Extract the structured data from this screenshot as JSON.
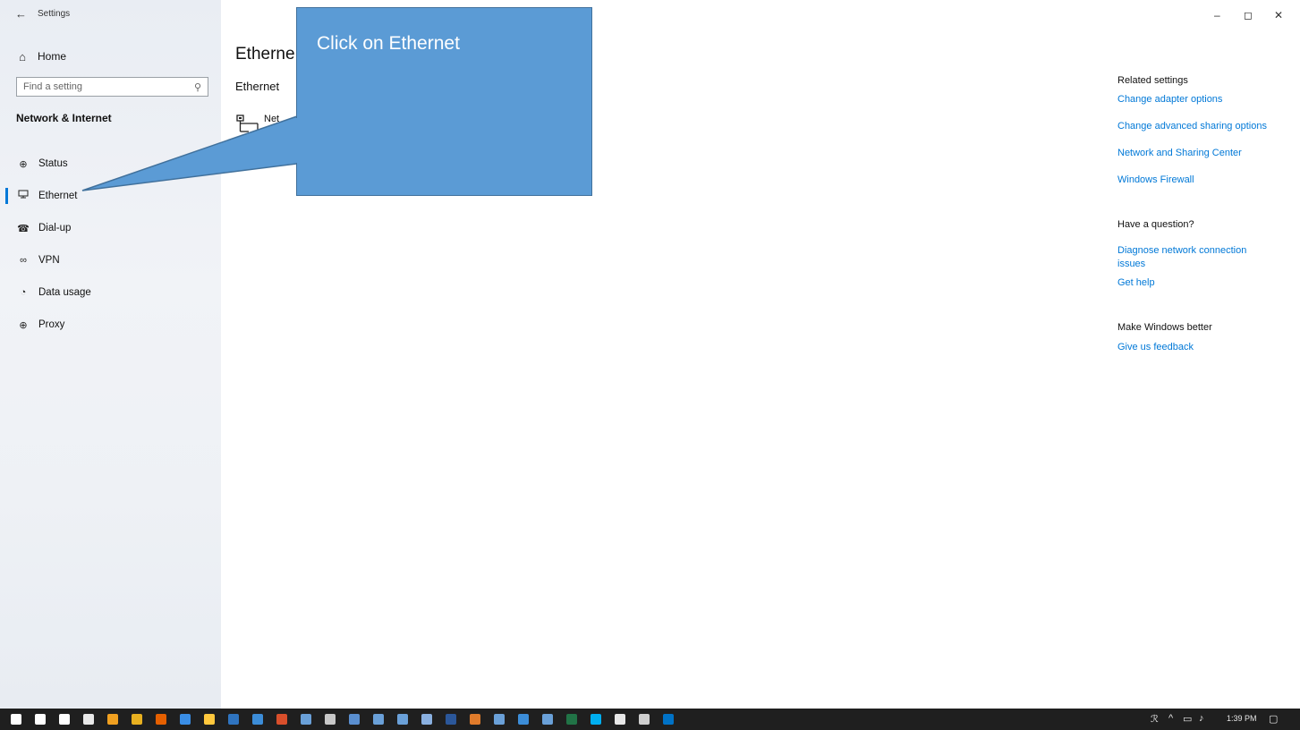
{
  "window": {
    "title": "Settings",
    "back_icon": "back-arrow-icon",
    "minimize": "–",
    "maximize": "◻",
    "close": "✕"
  },
  "sidebar": {
    "home_label": "Home",
    "search_placeholder": "Find a setting",
    "section_title": "Network & Internet",
    "items": [
      {
        "label": "Status",
        "icon": "status-globe-icon",
        "glyph": "⊕",
        "active": false
      },
      {
        "label": "Ethernet",
        "icon": "ethernet-icon",
        "glyph": "🖧",
        "active": true
      },
      {
        "label": "Dial-up",
        "icon": "dial-up-icon",
        "glyph": "☎",
        "active": false
      },
      {
        "label": "VPN",
        "icon": "vpn-icon",
        "glyph": "∞",
        "active": false
      },
      {
        "label": "Data usage",
        "icon": "data-usage-icon",
        "glyph": "◔",
        "active": false
      },
      {
        "label": "Proxy",
        "icon": "proxy-globe-icon",
        "glyph": "⊕",
        "active": false
      }
    ]
  },
  "main": {
    "title": "Etherne",
    "subtitle": "Ethernet",
    "network_name": "Net"
  },
  "callout": {
    "text": "Click on Ethernet",
    "fill": "#5b9bd5",
    "border": "#41719c"
  },
  "right_panel": {
    "related_heading": "Related settings",
    "related_links": [
      "Change adapter options",
      "Change advanced sharing options",
      "Network and Sharing Center",
      "Windows Firewall"
    ],
    "question_heading": "Have a question?",
    "question_links": [
      "Diagnose network connection issues",
      "Get help"
    ],
    "better_heading": "Make Windows better",
    "better_links": [
      "Give us feedback"
    ]
  },
  "taskbar": {
    "time": "1:39 PM",
    "apps": [
      {
        "name": "start-button",
        "color": "#ffffff"
      },
      {
        "name": "cortana-search",
        "color": "#ffffff"
      },
      {
        "name": "task-view",
        "color": "#ffffff"
      },
      {
        "name": "store-app",
        "color": "#e8e8e8"
      },
      {
        "name": "media-app",
        "color": "#f0a020"
      },
      {
        "name": "chrome-app",
        "color": "#e8b020"
      },
      {
        "name": "firefox-app",
        "color": "#e66000"
      },
      {
        "name": "edge-app",
        "color": "#3a8ee6"
      },
      {
        "name": "explorer-app",
        "color": "#ffc83d"
      },
      {
        "name": "app-10",
        "color": "#2f74c0"
      },
      {
        "name": "app-11",
        "color": "#3c8dd8"
      },
      {
        "name": "app-12",
        "color": "#d94f2b"
      },
      {
        "name": "app-13",
        "color": "#6aa0d8"
      },
      {
        "name": "app-14",
        "color": "#c8c8c8"
      },
      {
        "name": "app-15",
        "color": "#5a8fd0"
      },
      {
        "name": "app-16",
        "color": "#6aa0d8"
      },
      {
        "name": "app-17",
        "color": "#6aa0d8"
      },
      {
        "name": "app-18",
        "color": "#8ab0e0"
      },
      {
        "name": "word-app",
        "color": "#2b579a"
      },
      {
        "name": "app-20",
        "color": "#e07b2b"
      },
      {
        "name": "app-21",
        "color": "#6aa0d8"
      },
      {
        "name": "app-22",
        "color": "#3c8dd8"
      },
      {
        "name": "app-23",
        "color": "#6aa0d8"
      },
      {
        "name": "excel-app",
        "color": "#217346"
      },
      {
        "name": "skype-app",
        "color": "#00aff0"
      },
      {
        "name": "app-26",
        "color": "#e8e8e8"
      },
      {
        "name": "settings-app",
        "color": "#cfcfcf"
      },
      {
        "name": "outlook-app",
        "color": "#0072c6"
      }
    ]
  }
}
